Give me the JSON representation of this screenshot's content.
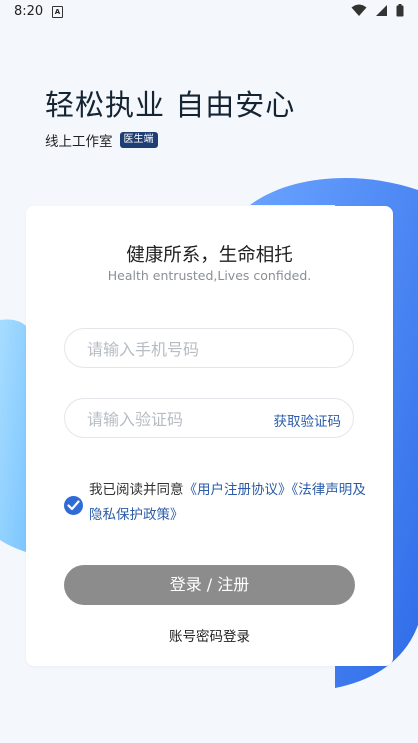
{
  "status_bar": {
    "time": "8:20",
    "notification_icon": "A"
  },
  "headline": "轻松执业 自由安心",
  "subtitle": "线上工作室",
  "badge": "医生端",
  "card": {
    "slogan": "健康所系，生命相托",
    "slogan_en": "Health entrusted,Lives confided.",
    "phone_placeholder": "请输入手机号码",
    "code_placeholder": "请输入验证码",
    "get_code": "获取验证码",
    "agree_prefix": "我已阅读并同意",
    "agreement_link": "《用户注册协议》",
    "privacy_link": "《法律声明及隐私保护政策》",
    "login_button": "登录 / 注册",
    "password_login": "账号密码登录"
  },
  "colors": {
    "accent": "#2c5ca8",
    "badge_bg": "#1f3f74",
    "button_disabled": "#8c8c8c",
    "blob_blue": "#3a7cf0",
    "blob_light": "#8fd0ff"
  }
}
